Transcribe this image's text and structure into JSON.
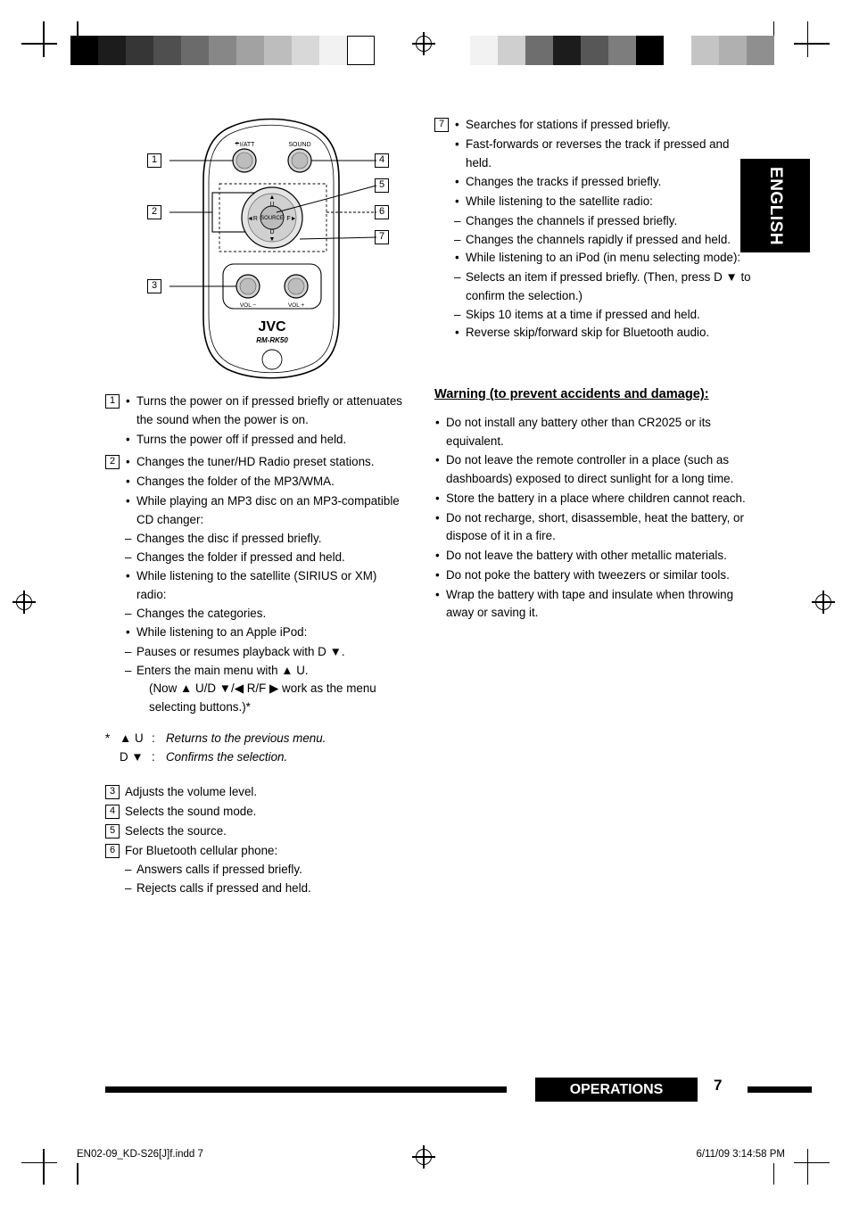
{
  "sidetab": {
    "label": "ENGLISH"
  },
  "remote": {
    "brand": "JVC",
    "model": "RM-RK50",
    "buttons": {
      "power": "/I/ATT",
      "sound": "SOUND",
      "source": "SOURCE",
      "up": "U",
      "down": "D",
      "left": "R",
      "right": "F",
      "vol_down": "VOL −",
      "vol_up": "VOL +"
    },
    "callouts": [
      "1",
      "2",
      "3",
      "4",
      "5",
      "6",
      "7"
    ]
  },
  "left_column": {
    "item1": {
      "num": "1",
      "bullets": [
        "Turns the power on if pressed briefly or attenuates the sound when the power is on.",
        "Turns the power off if pressed and held."
      ]
    },
    "item2": {
      "num": "2",
      "bullets": [
        "Changes the tuner/HD Radio preset stations.",
        "Changes the folder of the MP3/WMA.",
        "While playing an MP3 disc on an MP3-compatible CD changer:",
        "While listening to the satellite (SIRIUS or XM) radio:",
        "While listening to an Apple iPod:"
      ],
      "sub_cdchanger": [
        "Changes the disc if pressed briefly.",
        "Changes the folder if pressed and held."
      ],
      "sub_satellite": [
        "Changes the categories."
      ],
      "sub_ipod": [
        "Pauses or resumes playback with D ▼.",
        "Enters the main menu with ▲ U."
      ],
      "sub_ipod_note": "(Now ▲ U/D ▼/◀ R/F ▶ work as the menu selecting buttons.)*"
    },
    "footnote": {
      "star": "*",
      "line1_sym": "▲ U",
      "line1_colon": ":",
      "line1_text": "Returns to the previous menu.",
      "line2_sym": "D ▼",
      "line2_colon": ":",
      "line2_text": "Confirms the selection."
    },
    "items_simple": [
      {
        "num": "3",
        "text": "Adjusts the volume level."
      },
      {
        "num": "4",
        "text": "Selects the sound mode."
      },
      {
        "num": "5",
        "text": "Selects the source."
      },
      {
        "num": "6",
        "text": "For Bluetooth cellular phone:"
      }
    ],
    "item6_sub": [
      "Answers calls if pressed briefly.",
      "Rejects calls if pressed and held."
    ]
  },
  "right_column": {
    "item7": {
      "num": "7",
      "bullets": [
        "Searches for stations if pressed briefly.",
        "Fast-forwards or reverses the track if pressed and held.",
        "Changes the tracks if pressed briefly.",
        "While listening to the satellite radio:",
        "While listening to an iPod (in menu selecting mode):",
        "Reverse skip/forward skip for Bluetooth audio."
      ],
      "sub_satellite": [
        "Changes the channels if pressed briefly.",
        "Changes the channels rapidly if pressed and held."
      ],
      "sub_ipod": [
        "Selects an item if pressed briefly. (Then, press D ▼ to confirm the selection.)",
        "Skips 10 items at a time if pressed and held."
      ]
    },
    "warning": {
      "title": "Warning (to prevent accidents and damage):",
      "bullets": [
        "Do not install any battery other than CR2025 or its equivalent.",
        "Do not leave the remote controller in a place (such as dashboards) exposed to direct sunlight for a long time.",
        "Store the battery in a place where children cannot reach.",
        "Do not recharge, short, disassemble, heat the battery, or dispose of it in a fire.",
        "Do not leave the battery with other metallic materials.",
        "Do not poke the battery with tweezers or similar tools.",
        "Wrap the battery with tape and insulate when throwing away or saving it."
      ]
    }
  },
  "footer": {
    "section": "OPERATIONS",
    "page": "7",
    "imprint_left": "EN02-09_KD-S26[J]f.indd   7",
    "imprint_right": "6/11/09   3:14:58 PM"
  }
}
